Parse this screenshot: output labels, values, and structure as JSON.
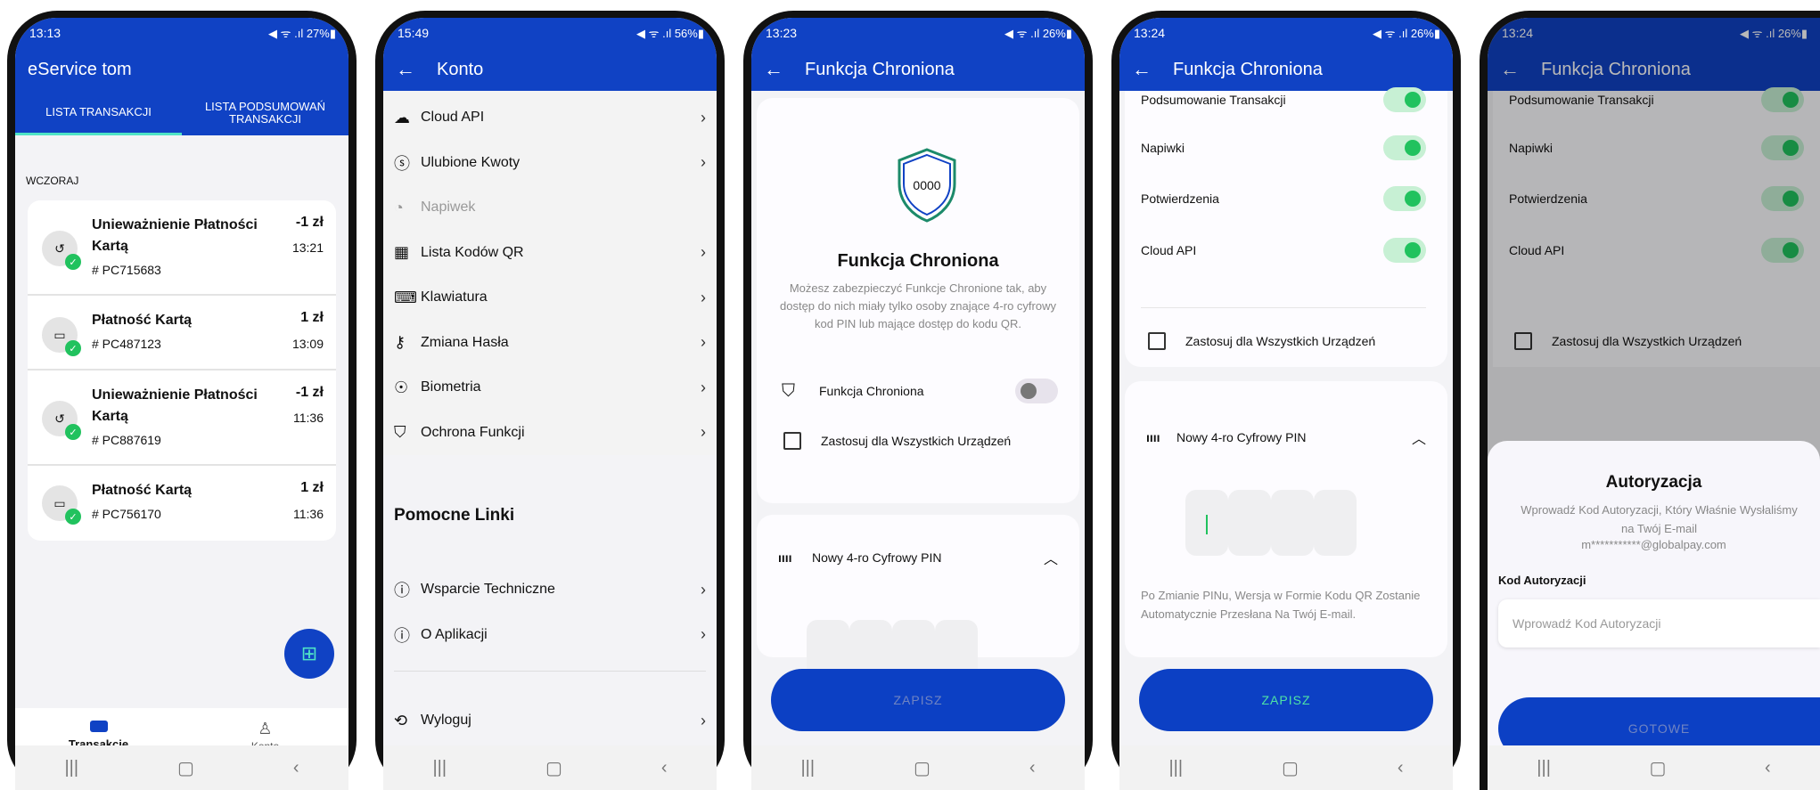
{
  "colors": {
    "primary": "#1042c4",
    "accent": "#4fe3c6",
    "success": "#21c25e"
  },
  "p1": {
    "status": {
      "time": "13:13",
      "right": "◀ ᯤ .ıl 27%▮"
    },
    "title": "eService tom",
    "tabs": [
      "LISTA TRANSAKCJI",
      "LISTA PODSUMOWAŃ TRANSAKCJI"
    ],
    "section": "WCZORAJ",
    "transactions": [
      {
        "title": "Unieważnienie Płatności Kartą",
        "id": "# PC715683",
        "amount": "-1 zł",
        "time": "13:21",
        "icon": "undo-icon"
      },
      {
        "title": "Płatność Kartą",
        "id": "# PC487123",
        "amount": "1 zł",
        "time": "13:09",
        "icon": "card-icon"
      },
      {
        "title": "Unieważnienie Płatności Kartą",
        "id": "# PC887619",
        "amount": "-1 zł",
        "time": "11:36",
        "icon": "undo-icon"
      },
      {
        "title": "Płatność Kartą",
        "id": "# PC756170",
        "amount": "1 zł",
        "time": "11:36",
        "icon": "card-icon"
      }
    ],
    "nav": [
      "Transakcje",
      "Konto"
    ]
  },
  "p2": {
    "status": {
      "time": "15:49",
      "right": "◀ ᯤ .ıl 56%▮"
    },
    "title": "Konto",
    "items": [
      "Cloud API",
      "Ulubione Kwoty",
      "Napiwek",
      "Lista Kodów QR",
      "Klawiatura",
      "Zmiana Hasła",
      "Biometria",
      "Ochrona Funkcji"
    ],
    "helpTitle": "Pomocne Linki",
    "helpItems": [
      "Wsparcie Techniczne",
      "O Aplikacji"
    ],
    "logout": "Wyloguj"
  },
  "p3": {
    "status": {
      "time": "13:23",
      "right": "◀ ᯤ .ıl 26%▮"
    },
    "title": "Funkcja Chroniona",
    "shieldText": "0000",
    "heading": "Funkcja Chroniona",
    "desc": "Możesz zabezpieczyć Funkcje Chronione tak, aby dostęp do nich miały tylko osoby znające 4-ro cyfrowy kod PIN lub mające dostęp do kodu QR.",
    "toggleLabel": "Funkcja Chroniona",
    "applyAll": "Zastosuj dla Wszystkich Urządzeń",
    "pinTitle": "Nowy 4-ro Cyfrowy PIN",
    "save": "ZAPISZ"
  },
  "p4": {
    "status": {
      "time": "13:24",
      "right": "◀ ᯤ .ıl 26%▮"
    },
    "title": "Funkcja Chroniona",
    "toggles": [
      "Podsumowanie Transakcji",
      "Napiwki",
      "Potwierdzenia",
      "Cloud API"
    ],
    "applyAll": "Zastosuj dla Wszystkich Urządzeń",
    "pinTitle": "Nowy 4-ro Cyfrowy PIN",
    "pinNote": "Po Zmianie PINu, Wersja w Formie Kodu QR Zostanie Automatycznie Przesłana Na Twój E-mail.",
    "save": "ZAPISZ"
  },
  "p5": {
    "status": {
      "time": "13:24",
      "right": "◀ ᯤ .ıl 26%▮"
    },
    "title": "Funkcja Chroniona",
    "toggles": [
      "Podsumowanie Transakcji",
      "Napiwki",
      "Potwierdzenia",
      "Cloud API"
    ],
    "applyAll": "Zastosuj dla Wszystkich Urządzeń",
    "sheetTitle": "Autoryzacja",
    "sheetDesc": "Wprowadź Kod Autoryzacji, Który Właśnie Wysłaliśmy na Twój E-mail",
    "email": "m***********@globalpay.com",
    "codeLabel": "Kod Autoryzacji",
    "codePlaceholder": "Wprowadź Kod Autoryzacji",
    "done": "GOTOWE"
  }
}
